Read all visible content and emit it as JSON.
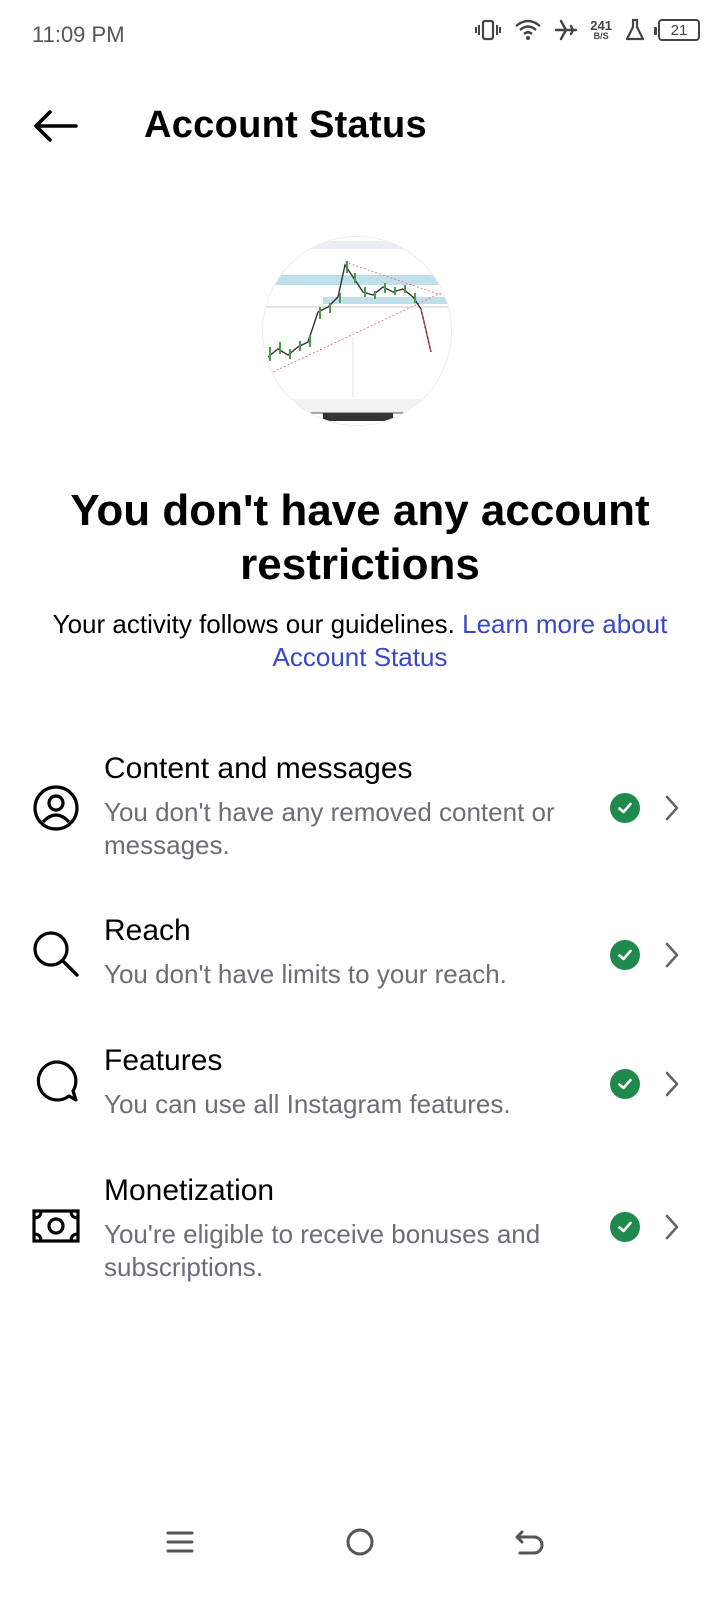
{
  "status_bar": {
    "time": "11:09 PM",
    "net_speed_value": "241",
    "net_speed_unit": "B/S",
    "battery_level": "21",
    "icons": [
      "vibrate-icon",
      "wifi-icon",
      "airplane-mode-icon",
      "flask-icon",
      "battery-icon"
    ]
  },
  "header": {
    "title": "Account Status",
    "back_icon": "arrow-left-icon"
  },
  "hero": {
    "headline": "You don't have any account restrictions",
    "subtitle": "Your activity follows our guidelines.",
    "link_text": "Learn more about Account Status"
  },
  "items": [
    {
      "title": "Content and messages",
      "description": "You don't have any removed content or messages.",
      "icon": "user-circle-icon",
      "status": "check"
    },
    {
      "title": "Reach",
      "description": "You don't have limits to your reach.",
      "icon": "search-icon",
      "status": "check"
    },
    {
      "title": "Features",
      "description": "You can use all Instagram features.",
      "icon": "chat-bubble-icon",
      "status": "check"
    },
    {
      "title": "Monetization",
      "description": "You're eligible to receive bonuses and subscriptions.",
      "icon": "money-icon",
      "status": "check"
    }
  ],
  "colors": {
    "link": "#3b48c4",
    "check": "#1f8a4c",
    "secondary_text": "#6a6e76"
  },
  "nav": [
    "menu-icon",
    "home-circle-icon",
    "back-return-icon"
  ]
}
